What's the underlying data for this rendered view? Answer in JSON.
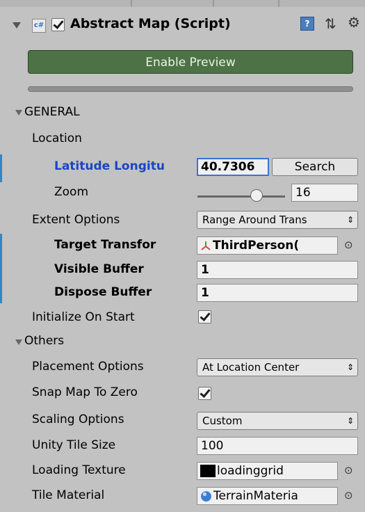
{
  "component": {
    "title": "Abstract Map (Script)",
    "script_badge": "c#",
    "enabled": true,
    "help_icon": "?"
  },
  "enable_preview_label": "Enable Preview",
  "general": {
    "section_label": "GENERAL",
    "location_label": "Location",
    "latlon_label": "Latitude Longitu",
    "latlon_value": "40.7306",
    "search_label": "Search",
    "zoom_label": "Zoom",
    "zoom_value": "16",
    "extent_label": "Extent Options",
    "extent_value": "Range Around Trans",
    "target_label": "Target Transfor",
    "target_value": "ThirdPerson(",
    "visible_label": "Visible Buffer",
    "visible_value": "1",
    "dispose_label": "Dispose Buffer",
    "dispose_value": "1",
    "init_label": "Initialize On Start",
    "init_checked": true
  },
  "others": {
    "section_label": "Others",
    "placement_label": "Placement Options",
    "placement_value": "At Location Center",
    "snap_label": "Snap Map To Zero",
    "snap_checked": true,
    "scaling_label": "Scaling Options",
    "scaling_value": "Custom",
    "tile_size_label": "Unity Tile Size",
    "tile_size_value": "100",
    "loading_label": "Loading Texture",
    "loading_value": "loadinggrid",
    "material_label": "Tile Material",
    "material_value": "TerrainMateria"
  },
  "colors": {
    "accent": "#3a72d6",
    "preview_button": "#4d7246",
    "modified_bar": "#2f86c8",
    "override_label": "#1a45c4"
  },
  "icons": {
    "foldout": "triangle-down",
    "script": "cs-script-icon",
    "help": "help-book-icon",
    "presets": "sliders-icon",
    "settings": "gear-icon",
    "object_picker": "target-circle-icon",
    "transform": "transform-axes-icon",
    "material": "sphere-icon"
  }
}
